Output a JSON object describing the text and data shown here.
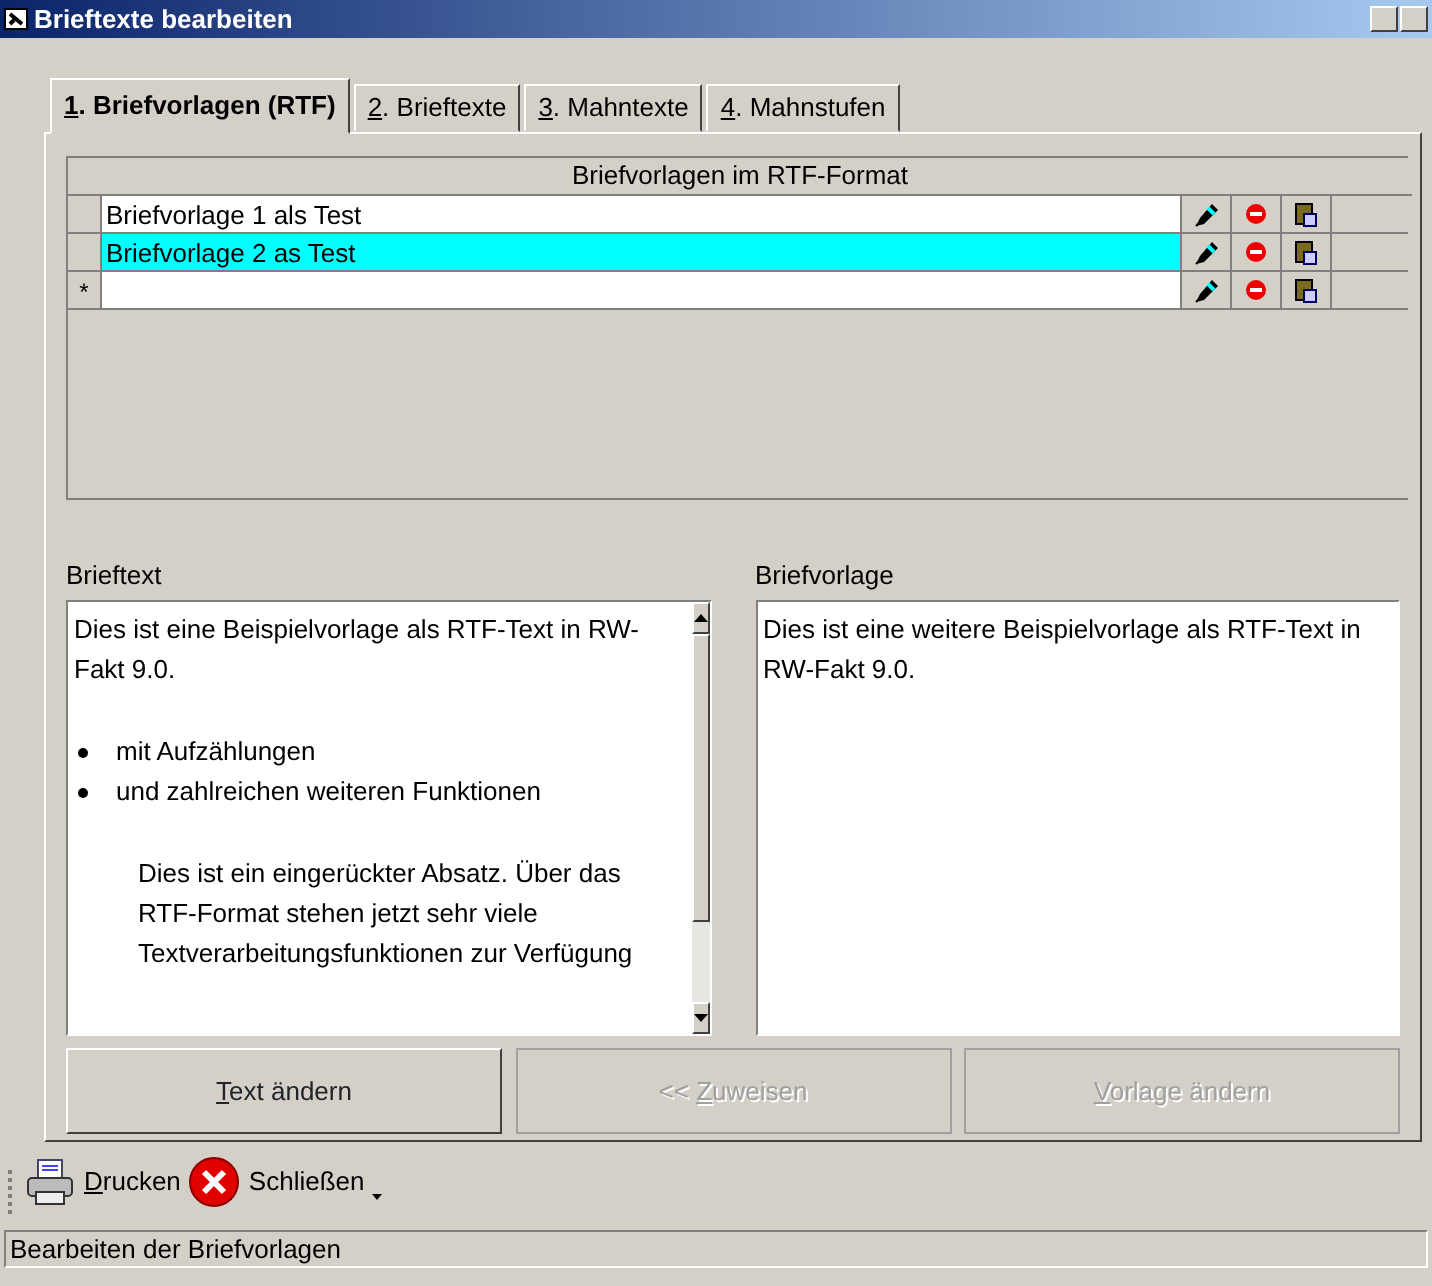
{
  "window": {
    "title": "Brieftexte bearbeiten"
  },
  "tabs": [
    {
      "accel": "1",
      "rest": ". Briefvorlagen (RTF)",
      "selected": true
    },
    {
      "accel": "2",
      "rest": ". Brieftexte",
      "selected": false
    },
    {
      "accel": "3",
      "rest": ". Mahntexte",
      "selected": false
    },
    {
      "accel": "4",
      "rest": ". Mahnstufen",
      "selected": false
    }
  ],
  "grid": {
    "header": "Briefvorlagen im RTF-Format",
    "rows": [
      {
        "marker": "",
        "text": "Briefvorlage 1 als Test",
        "selected": false
      },
      {
        "marker": "",
        "text": "Briefvorlage 2 as Test",
        "selected": true
      },
      {
        "marker": "*",
        "text": "",
        "selected": false
      }
    ]
  },
  "brieftext": {
    "label": "Brieftext",
    "paragraphs": [
      {
        "kind": "plain",
        "text": "Dies ist eine Beispielvorlage als RTF-Text in RW-Fakt 9.0."
      },
      {
        "kind": "bullet",
        "text": "mit Aufzählungen"
      },
      {
        "kind": "bullet",
        "text": "und zahlreichen weiteren Funktionen"
      },
      {
        "kind": "indented",
        "text": "Dies ist ein eingerückter Absatz. Über das RTF-Format stehen jetzt sehr viele Textverarbeitungsfunktionen zur Verfügung"
      }
    ]
  },
  "briefvorlage": {
    "label": "Briefvorlage",
    "text": "Dies ist eine weitere Beispielvorlage als RTF-Text in RW-Fakt 9.0."
  },
  "buttons": [
    {
      "accel": "T",
      "rest": "ext ändern",
      "disabled": false
    },
    {
      "prefix": "<< ",
      "accel": "Z",
      "rest": "uweisen",
      "disabled": true
    },
    {
      "accel": "V",
      "rest": "orlage ändern",
      "disabled": true
    }
  ],
  "toolbar": [
    {
      "kind": "print",
      "accel": "D",
      "rest": "rucken"
    },
    {
      "kind": "close",
      "rest": "Schließen"
    }
  ],
  "status_bar": "Bearbeiten der Briefvorlagen"
}
